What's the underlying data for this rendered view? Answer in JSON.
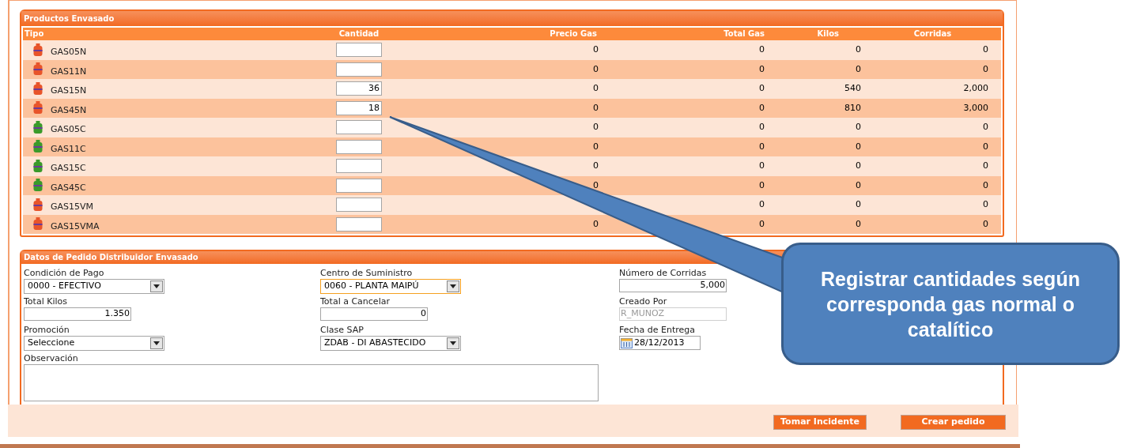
{
  "products_panel": {
    "title": "Productos Envasado",
    "columns": [
      "Tipo",
      "Cantidad",
      "Precio Gas",
      "Total Gas",
      "Kilos",
      "Corridas"
    ],
    "rows": [
      {
        "tipo": "GAS05N",
        "color": "#e8542a",
        "cantidad": "",
        "precio_gas": "0",
        "total_gas": "0",
        "kilos": "0",
        "corridas": "0"
      },
      {
        "tipo": "GAS11N",
        "color": "#e8542a",
        "cantidad": "",
        "precio_gas": "0",
        "total_gas": "0",
        "kilos": "0",
        "corridas": "0"
      },
      {
        "tipo": "GAS15N",
        "color": "#e8542a",
        "cantidad": "36",
        "precio_gas": "0",
        "total_gas": "0",
        "kilos": "540",
        "corridas": "2,000"
      },
      {
        "tipo": "GAS45N",
        "color": "#e8542a",
        "cantidad": "18",
        "precio_gas": "0",
        "total_gas": "0",
        "kilos": "810",
        "corridas": "3,000"
      },
      {
        "tipo": "GAS05C",
        "color": "#3a9a2a",
        "cantidad": "",
        "precio_gas": "0",
        "total_gas": "0",
        "kilos": "0",
        "corridas": "0"
      },
      {
        "tipo": "GAS11C",
        "color": "#3a9a2a",
        "cantidad": "",
        "precio_gas": "0",
        "total_gas": "0",
        "kilos": "0",
        "corridas": "0"
      },
      {
        "tipo": "GAS15C",
        "color": "#3a9a2a",
        "cantidad": "",
        "precio_gas": "0",
        "total_gas": "0",
        "kilos": "0",
        "corridas": "0"
      },
      {
        "tipo": "GAS45C",
        "color": "#3a9a2a",
        "cantidad": "",
        "precio_gas": "0",
        "total_gas": "0",
        "kilos": "0",
        "corridas": "0"
      },
      {
        "tipo": "GAS15VM",
        "color": "#e8542a",
        "cantidad": "",
        "total_gas": "0",
        "kilos": "0",
        "corridas": "0"
      },
      {
        "tipo": "GAS15VMA",
        "color": "#e8542a",
        "cantidad": "",
        "precio_gas": "0",
        "total_gas": "0",
        "kilos": "0",
        "corridas": "0"
      }
    ]
  },
  "order_panel": {
    "title": "Datos de Pedido Distribuidor Envasado",
    "columns": [
      [
        {
          "label": "Condición de Pago",
          "kind": "select",
          "value": "0000 - EFECTIVO",
          "focused": false
        },
        {
          "label": "Total Kilos",
          "kind": "text",
          "value": "1.350",
          "focused": false,
          "disabled": false
        },
        {
          "label": "Promoción",
          "kind": "select",
          "value": "Seleccione",
          "focused": false
        }
      ],
      [
        {
          "label": "Centro de Suministro",
          "kind": "select",
          "value": "0060 - PLANTA MAIPÚ",
          "focused": true
        },
        {
          "label": "Total a Cancelar",
          "kind": "text",
          "value": "0",
          "focused": false,
          "disabled": false
        },
        {
          "label": "Clase SAP",
          "kind": "select",
          "value": "ZDAB - DI ABASTECIDO",
          "focused": false
        }
      ],
      [
        {
          "label": "Número de Corridas",
          "kind": "text",
          "value": "5,000",
          "focused": false,
          "disabled": false
        },
        {
          "label": "Creado Por",
          "kind": "text",
          "value": "R_MUNOZ",
          "focused": false,
          "disabled": true
        },
        {
          "label": "Fecha de Entrega",
          "kind": "date",
          "value": "28/12/2013",
          "focused": false
        }
      ]
    ],
    "observation": {
      "label": "Observación"
    }
  },
  "buttons": [
    "Tomar Incidente",
    "Crear pedido"
  ],
  "callout": {
    "text": "Registrar cantidades según corresponda gas normal o catalítico"
  }
}
